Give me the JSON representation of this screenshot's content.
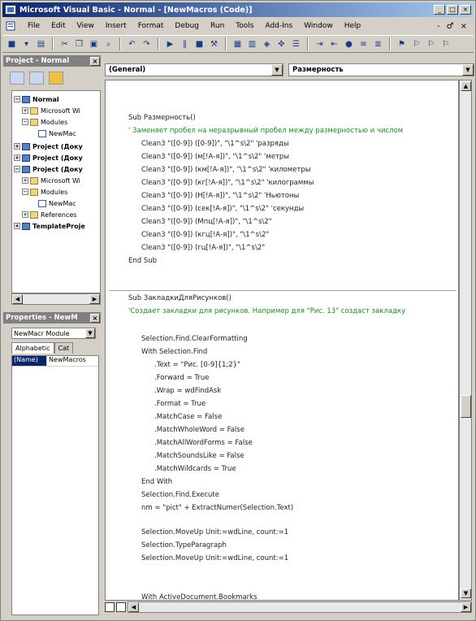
{
  "window": {
    "title": "Microsoft Visual Basic - Normal - [NewMacros (Code)]",
    "controls": [
      "_",
      "□",
      "×"
    ]
  },
  "menu": {
    "items": [
      "File",
      "Edit",
      "View",
      "Insert",
      "Format",
      "Debug",
      "Run",
      "Tools",
      "Add-Ins",
      "Window",
      "Help"
    ],
    "right": [
      "-",
      "♂",
      "×"
    ]
  },
  "project_panel": {
    "title": "Project - Normal",
    "close": "×",
    "tree": [
      {
        "label": "Normal",
        "level": 0,
        "bold": true,
        "pm": "−",
        "icon": "project"
      },
      {
        "label": "Microsoft Wi",
        "level": 1,
        "bold": false,
        "pm": "+",
        "icon": "folder"
      },
      {
        "label": "Modules",
        "level": 1,
        "bold": false,
        "pm": "−",
        "icon": "folder"
      },
      {
        "label": "NewMac",
        "level": 2,
        "bold": false,
        "pm": "",
        "icon": "module"
      },
      {
        "label": "Project (Доку",
        "level": 0,
        "bold": true,
        "pm": "+",
        "icon": "project"
      },
      {
        "label": "Project (Доку",
        "level": 0,
        "bold": true,
        "pm": "+",
        "icon": "project"
      },
      {
        "label": "Project (Доку",
        "level": 0,
        "bold": true,
        "pm": "−",
        "icon": "project"
      },
      {
        "label": "Microsoft Wi",
        "level": 1,
        "bold": false,
        "pm": "+",
        "icon": "folder"
      },
      {
        "label": "Modules",
        "level": 1,
        "bold": false,
        "pm": "−",
        "icon": "folder"
      },
      {
        "label": "NewMac",
        "level": 2,
        "bold": false,
        "pm": "",
        "icon": "module"
      },
      {
        "label": "References",
        "level": 1,
        "bold": false,
        "pm": "+",
        "icon": "folder"
      },
      {
        "label": "TemplateProje",
        "level": 0,
        "bold": true,
        "pm": "+",
        "icon": "project"
      }
    ]
  },
  "properties_panel": {
    "title": "Properties - NewM",
    "close": "×",
    "object_selector": "NewMacr Module",
    "tabs": [
      "Alphabetic",
      "Cat"
    ],
    "rows": [
      {
        "key": "(Name)",
        "value": "NewMacros"
      }
    ]
  },
  "code_window": {
    "object_combo": "(General)",
    "procedure_combo": "Размерность",
    "lines": [
      {
        "text": "Sub Размерность()",
        "indent": 0,
        "type": "code"
      },
      {
        "text": "' Заменяет пробел на неразрывный пробел между размерностью и числом",
        "indent": 0,
        "type": "comment"
      },
      {
        "text": "Clean3 \"([0-9]) ([0-9])\", \"\\1^s\\2\" 'разряды",
        "indent": 1,
        "type": "code"
      },
      {
        "text": "Clean3 \"([0-9]) (м[!А-я])\", \"\\1^s\\2\" 'метры",
        "indent": 1,
        "type": "code"
      },
      {
        "text": "Clean3 \"([0-9]) (км[!А-я])\", \"\\1^s\\2\" 'километры",
        "indent": 1,
        "type": "code"
      },
      {
        "text": "Clean3 \"([0-9]) (кг[!А-я])\", \"\\1^s\\2\" 'килограммы",
        "indent": 1,
        "type": "code"
      },
      {
        "text": "Clean3 \"([0-9]) (Н[!А-я])\", \"\\1^s\\2\" 'Ньютоны",
        "indent": 1,
        "type": "code"
      },
      {
        "text": "Clean3 \"([0-9]) (сек[!А-я])\", \"\\1^s\\2\" 'секунды",
        "indent": 1,
        "type": "code"
      },
      {
        "text": "Clean3 \"([0-9]) (Мпц[!А-я])\", \"\\1^s\\2\"",
        "indent": 1,
        "type": "code"
      },
      {
        "text": "Clean3 \"([0-9]) (кгц[!А-я])\", \"\\1^s\\2\"",
        "indent": 1,
        "type": "code"
      },
      {
        "text": "Clean3 \"([0-9]) (гц[!А-я])\", \"\\1^s\\2\"",
        "indent": 1,
        "type": "code"
      },
      {
        "text": "End Sub",
        "indent": 0,
        "type": "code"
      },
      {
        "text": "Sub ЗакладкиДляРисунков()",
        "indent": 0,
        "type": "code"
      },
      {
        "text": "'Создает закладки для рисунков. Например для \"Рис. 13\" создаст закладку",
        "indent": 0,
        "type": "comment"
      },
      {
        "text": "Selection.Find.ClearFormatting",
        "indent": 1,
        "type": "code"
      },
      {
        "text": "With Selection.Find",
        "indent": 1,
        "type": "code"
      },
      {
        "text": ".Text = \"Рис. [0-9]{1;2}\"",
        "indent": 2,
        "type": "code"
      },
      {
        "text": ".Forward = True",
        "indent": 2,
        "type": "code"
      },
      {
        "text": ".Wrap = wdFindAsk",
        "indent": 2,
        "type": "code"
      },
      {
        "text": ".Format = True",
        "indent": 2,
        "type": "code"
      },
      {
        "text": ".MatchCase = False",
        "indent": 2,
        "type": "code"
      },
      {
        "text": ".MatchWholeWord = False",
        "indent": 2,
        "type": "code"
      },
      {
        "text": ".MatchAllWordForms = False",
        "indent": 2,
        "type": "code"
      },
      {
        "text": ".MatchSoundsLike = False",
        "indent": 2,
        "type": "code"
      },
      {
        "text": ".MatchWildcards = True",
        "indent": 2,
        "type": "code"
      },
      {
        "text": "End With",
        "indent": 1,
        "type": "code"
      },
      {
        "text": "Selection.Find.Execute",
        "indent": 1,
        "type": "code"
      },
      {
        "text": "nm = \"pict\" + ExtractNumer(Selection.Text)",
        "indent": 1,
        "type": "code"
      },
      {
        "text": "Selection.MoveUp Unit:=wdLine, count:=1",
        "indent": 1,
        "type": "code"
      },
      {
        "text": "Selection.TypeParagraph",
        "indent": 1,
        "type": "code"
      },
      {
        "text": "Selection.MoveUp Unit:=wdLine, count:=1",
        "indent": 1,
        "type": "code"
      },
      {
        "text": "With ActiveDocument.Bookmarks",
        "indent": 1,
        "type": "code"
      }
    ]
  }
}
